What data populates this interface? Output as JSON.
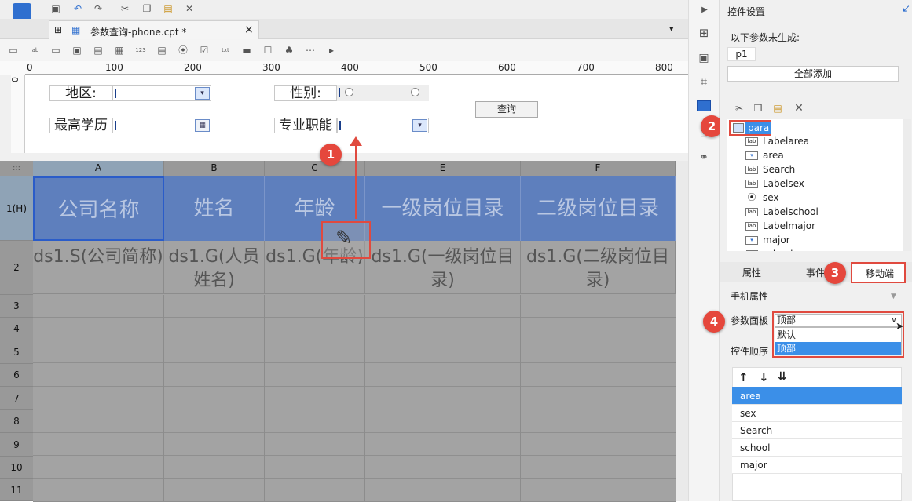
{
  "editor": {
    "tab_title": "参数查询-phone.cpt *",
    "tab_close": "×",
    "ruler": {
      "zero": "0",
      "marks": [
        "100",
        "200",
        "300",
        "400",
        "500",
        "600",
        "700",
        "800"
      ],
      "vzero": "0"
    },
    "param_panel": {
      "area_label": "地区:",
      "sex_label": "性别:",
      "school_label": "最高学历",
      "major_label": "专业职能",
      "query_button": "查询"
    },
    "sheet": {
      "corner": ":::",
      "columns": [
        "A",
        "B",
        "C",
        "E",
        "F"
      ],
      "rows": [
        "1(H)",
        "2",
        "3",
        "4",
        "5",
        "6",
        "7",
        "8",
        "9",
        "10",
        "11"
      ],
      "header_cells": [
        "公司名称",
        "姓名",
        "年龄",
        "一级岗位目录",
        "二级岗位目录"
      ],
      "data_cells": [
        "ds1.S(公司简称)",
        "ds1.G(人员姓名)",
        "ds1.G(年龄)",
        "ds1.G(一级岗位目录)",
        "ds1.G(二级岗位目录)"
      ]
    }
  },
  "right_panel": {
    "title": "控件设置",
    "notice": "以下参数未生成:",
    "param_name": "p1",
    "add_all_button": "全部添加",
    "tree": {
      "root": "para",
      "items": [
        {
          "label": "Labelarea",
          "icon": "label-icon"
        },
        {
          "label": "area",
          "icon": "combo-icon"
        },
        {
          "label": "Search",
          "icon": "label-icon"
        },
        {
          "label": "Labelsex",
          "icon": "label-icon"
        },
        {
          "label": "sex",
          "icon": "radio-icon"
        },
        {
          "label": "Labelschool",
          "icon": "label-icon"
        },
        {
          "label": "Labelmajor",
          "icon": "label-icon"
        },
        {
          "label": "major",
          "icon": "combo-icon"
        },
        {
          "label": "school",
          "icon": "combo-icon"
        }
      ]
    },
    "tabs": {
      "props": "属性",
      "events": "事件",
      "mobile": "移动端"
    },
    "mobile_props": "手机属性",
    "param_panel_label": "参数面板",
    "param_panel_value": "顶部",
    "dropdown_options": [
      "默认",
      "顶部"
    ],
    "control_order_label": "控件顺序",
    "order_list": [
      "area",
      "sex",
      "Search",
      "school",
      "major"
    ]
  },
  "annotations": {
    "b1": "1",
    "b2": "2",
    "b3": "3",
    "b4": "4"
  },
  "colors": {
    "header_blue": "#5e7fbd",
    "highlight_red": "#e04a3f",
    "selection_blue": "#3b8fe8"
  }
}
